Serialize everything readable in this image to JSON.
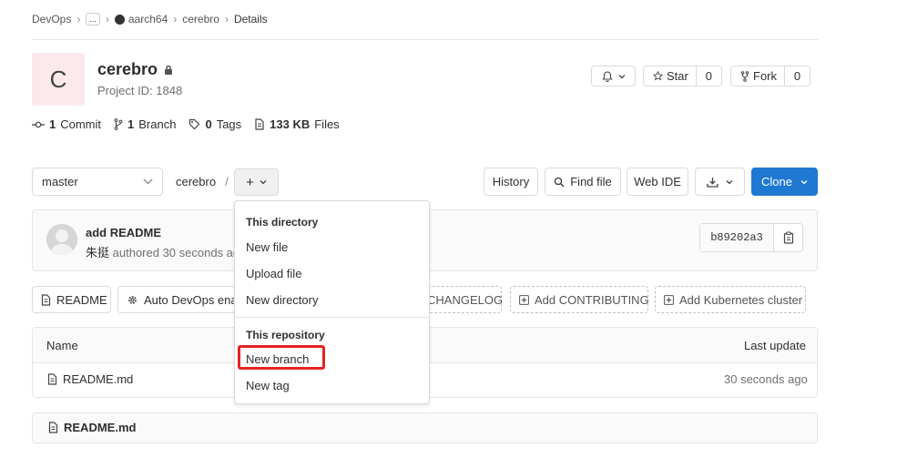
{
  "breadcrumb": {
    "items": [
      "DevOps",
      "...",
      "aarch64",
      "cerebro",
      "Details"
    ]
  },
  "project": {
    "avatar_letter": "C",
    "name": "cerebro",
    "id_text": "Project ID: 1848"
  },
  "actions": {
    "star_label": "Star",
    "star_count": "0",
    "fork_label": "Fork",
    "fork_count": "0"
  },
  "stats": {
    "commits_count": "1",
    "commits_label": "Commit",
    "branches_count": "1",
    "branches_label": "Branch",
    "tags_count": "0",
    "tags_label": "Tags",
    "files_size": "133 KB",
    "files_label": "Files"
  },
  "toolbar": {
    "branch": "master",
    "path": "cerebro",
    "path_sep": "/",
    "add_label": "+",
    "history_label": "History",
    "find_file_label": "Find file",
    "web_ide_label": "Web IDE",
    "clone_label": "Clone"
  },
  "commit": {
    "title": "add README",
    "author": "朱挺",
    "meta": "authored 30 seconds ag",
    "sha": "b89202a3"
  },
  "quick_buttons": {
    "readme": "README",
    "auto_devops": "Auto DevOps enal",
    "changelog": "CHANGELOG",
    "contributing": "Add CONTRIBUTING",
    "kubernetes": "Add Kubernetes cluster"
  },
  "file_table": {
    "col_name": "Name",
    "col_update": "Last update",
    "rows": [
      {
        "name": "README.md",
        "updated": "30 seconds ago"
      }
    ]
  },
  "readme_header": "README.md",
  "dropdown": {
    "section1": "This directory",
    "new_file": "New file",
    "upload_file": "Upload file",
    "new_directory": "New directory",
    "section2": "This repository",
    "new_branch": "New branch",
    "new_tag": "New tag"
  },
  "colors": {
    "primary": "#1f78d1",
    "highlight": "#e52222",
    "avatar_bg": "#fbe9eb"
  }
}
